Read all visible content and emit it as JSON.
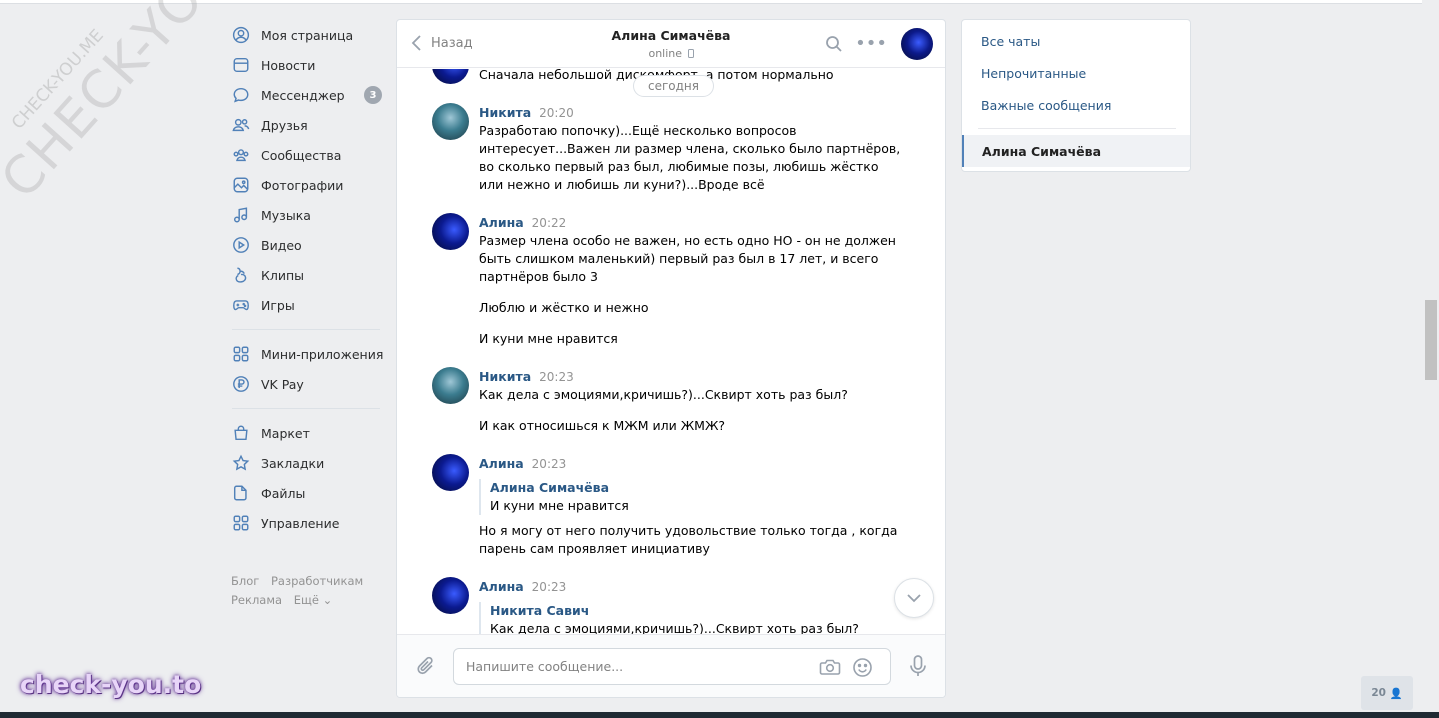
{
  "watermark": {
    "big": "CHECK-YOU.ME",
    "small": "CHECK-YOU.ME",
    "brand": "check-you.to"
  },
  "sidebar": {
    "items": [
      {
        "label": "Моя страница",
        "icon": "user-circle-icon"
      },
      {
        "label": "Новости",
        "icon": "newspaper-icon"
      },
      {
        "label": "Мессенджер",
        "icon": "chat-bubble-icon",
        "badge": "3"
      },
      {
        "label": "Друзья",
        "icon": "friends-icon"
      },
      {
        "label": "Сообщества",
        "icon": "communities-icon"
      },
      {
        "label": "Фотографии",
        "icon": "photo-icon"
      },
      {
        "label": "Музыка",
        "icon": "music-icon"
      },
      {
        "label": "Видео",
        "icon": "video-icon"
      },
      {
        "label": "Клипы",
        "icon": "clips-icon"
      },
      {
        "label": "Игры",
        "icon": "gamepad-icon"
      },
      {
        "label": "Мини-приложения",
        "icon": "apps-icon"
      },
      {
        "label": "VK Pay",
        "icon": "vkpay-icon"
      },
      {
        "label": "Маркет",
        "icon": "market-bag-icon"
      },
      {
        "label": "Закладки",
        "icon": "star-icon"
      },
      {
        "label": "Файлы",
        "icon": "file-icon"
      },
      {
        "label": "Управление",
        "icon": "manage-grid-icon"
      }
    ],
    "footer": [
      "Блог",
      "Разработчикам",
      "Реклама",
      "Ещё ⌄"
    ]
  },
  "chat": {
    "back_label": "Назад",
    "peer_name": "Алина Симачёва",
    "peer_status": "online",
    "date_separator": "сегодня",
    "input_placeholder": "Напишите сообщение...",
    "top_partial_text": "Сначала небольшой дискомфорт, а потом нормально",
    "messages": [
      {
        "author": "Никита",
        "time": "20:20",
        "lines": [
          "Разработаю попочку)...Ещё несколько вопросов",
          "интересует...Важен ли размер члена, сколько было партнёров,",
          "во сколько первый раз был, любимые позы, любишь жёстко",
          "или нежно и любишь ли куни?)...Вроде всё"
        ]
      },
      {
        "author": "Алина",
        "time": "20:22",
        "lines": [
          "Размер члена особо не важен, но есть одно НО - он не должен",
          "быть слишком маленький) первый раз был в 17 лет, и всего",
          "партнёров было 3"
        ],
        "extra": [
          "Люблю и жёстко и нежно",
          "И куни мне нравится"
        ]
      },
      {
        "author": "Никита",
        "time": "20:23",
        "lines": [
          "Как дела с эмоциями,кричишь?)...Сквирт хоть раз был?"
        ],
        "extra": [
          "И как относишься к МЖМ или ЖМЖ?"
        ]
      },
      {
        "author": "Алина",
        "time": "20:23",
        "quote": {
          "author": "Алина Симачёва",
          "text": "И куни мне нравится"
        },
        "lines": [
          "Но я могу от него получить удовольствие только тогда , когда",
          "парень сам проявляет инициативу"
        ]
      },
      {
        "author": "Алина",
        "time": "20:23",
        "quote": {
          "author": "Никита Савич",
          "text": "Как дела с эмоциями,кричишь?)...Сквирт хоть раз был?"
        }
      }
    ]
  },
  "right_panel": {
    "items": [
      "Все чаты",
      "Непрочитанные",
      "Важные сообщения"
    ],
    "active_chat": "Алина Симачёва"
  },
  "counter": "20"
}
